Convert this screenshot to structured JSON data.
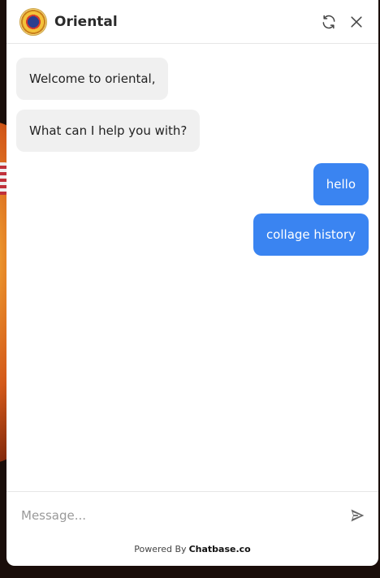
{
  "widget": {
    "title": "Oriental"
  },
  "messages": [
    {
      "role": "bot",
      "text": "Welcome to oriental,"
    },
    {
      "role": "bot",
      "text": "What can I help you with?"
    },
    {
      "role": "user",
      "text": "hello"
    },
    {
      "role": "user",
      "text": "collage history"
    }
  ],
  "composer": {
    "placeholder": "Message...",
    "powered_prefix": "Powered By",
    "powered_brand": "Chatbase.co"
  },
  "colors": {
    "user_bubble": "#3a84f1",
    "bot_bubble": "#f0f0f0"
  },
  "icons": {
    "refresh": "refresh-icon",
    "close": "close-icon",
    "send": "send-icon",
    "logo": "college-logo"
  }
}
